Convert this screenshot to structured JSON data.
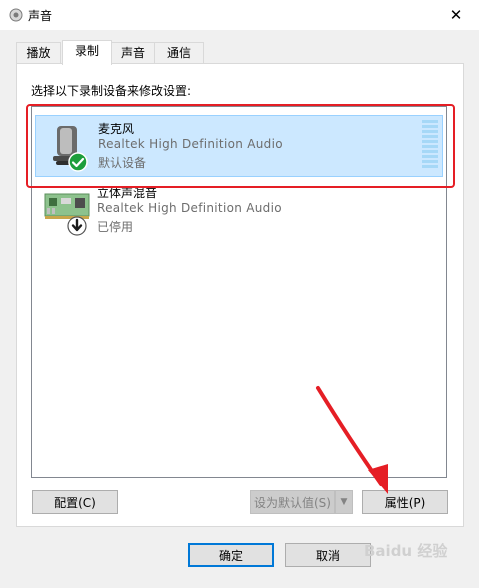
{
  "window": {
    "title": "声音",
    "close_glyph": "✕"
  },
  "tabs": [
    {
      "label": "播放",
      "active": false
    },
    {
      "label": "录制",
      "active": true
    },
    {
      "label": "声音",
      "active": false
    },
    {
      "label": "通信",
      "active": false
    }
  ],
  "instruction": "选择以下录制设备来修改设置:",
  "devices": [
    {
      "name": "麦克风",
      "driver": "Realtek High Definition Audio",
      "status": "默认设备",
      "icon": "microphone-icon",
      "badge": "check-badge-icon",
      "selected": true,
      "level_indicator": true
    },
    {
      "name": "立体声混音",
      "driver": "Realtek High Definition Audio",
      "status": "已停用",
      "icon": "sound-card-icon",
      "badge": "down-arrow-badge-icon",
      "selected": false
    }
  ],
  "buttons": {
    "configure": "配置(C)",
    "set_default": "设为默认值(S)",
    "properties": "属性(P)",
    "ok": "确定",
    "cancel": "取消"
  },
  "watermark": "Baidu 经验",
  "colors": {
    "highlight": "#e51e25",
    "selection": "#cce8ff",
    "accent": "#0078d7"
  }
}
